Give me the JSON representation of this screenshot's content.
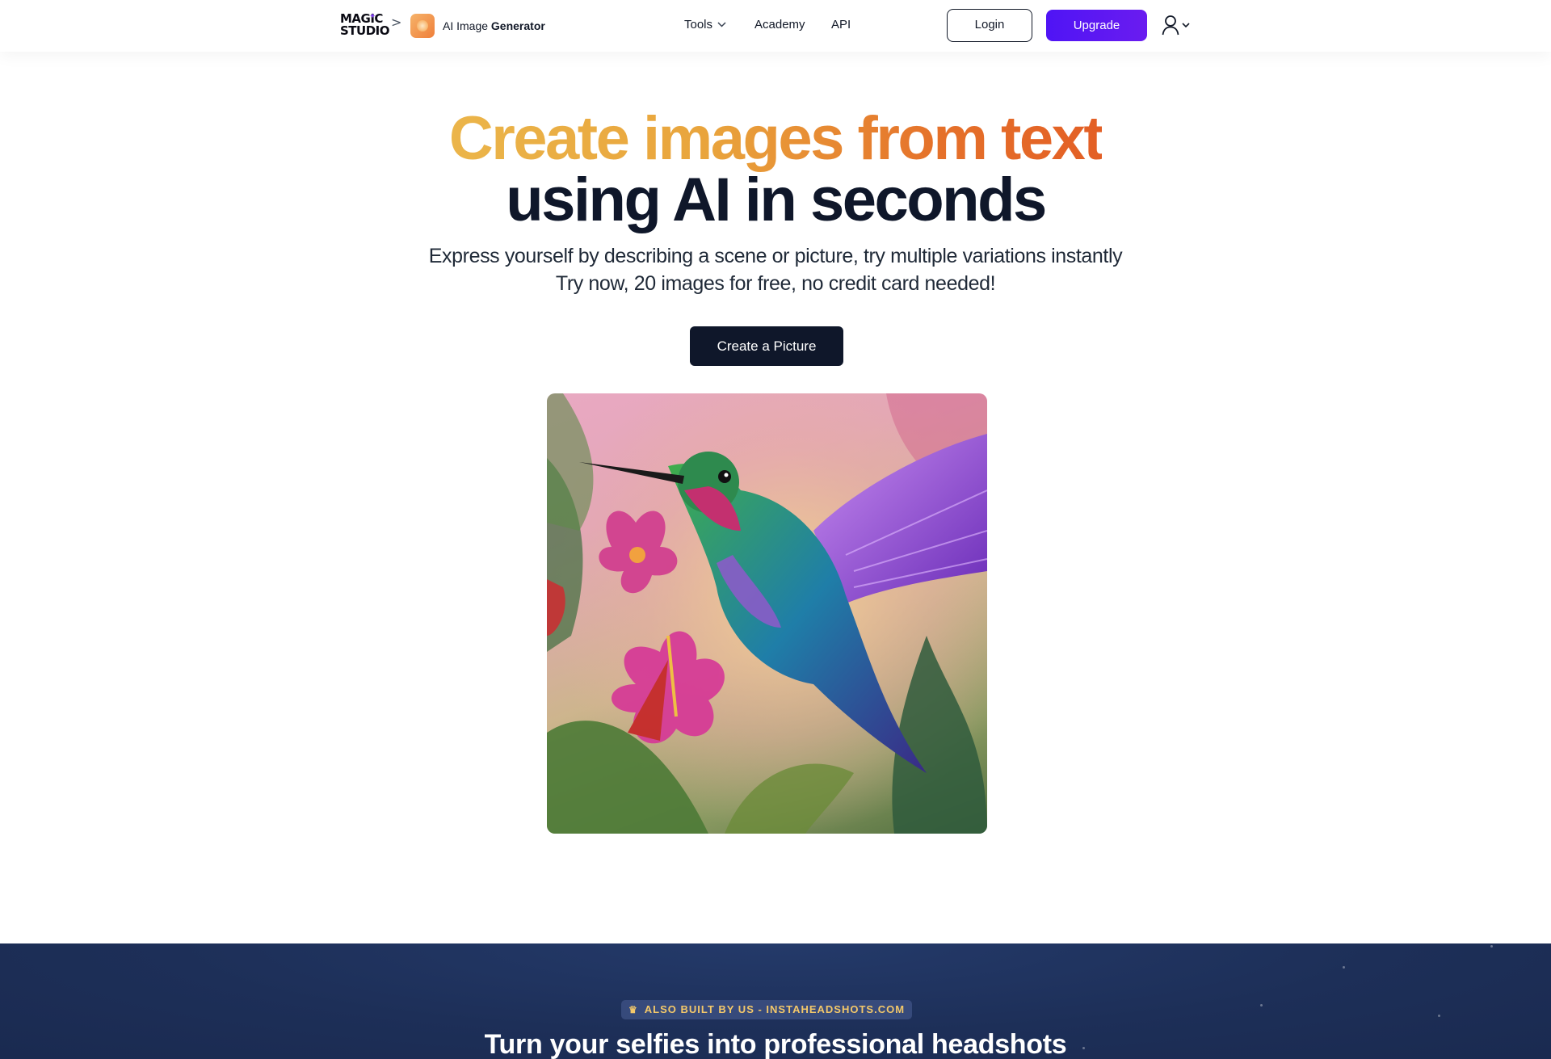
{
  "header": {
    "logo_line1": "MAGIC",
    "logo_line2": "STUDIO",
    "breadcrumb_separator": ">",
    "app_name_prefix": "AI Image",
    "app_name_bold": "Generator",
    "nav": {
      "tools": "Tools",
      "academy": "Academy",
      "api": "API"
    },
    "login_label": "Login",
    "upgrade_label": "Upgrade"
  },
  "hero": {
    "headline_gradient": "Create images from text",
    "headline_dark": "using AI in seconds",
    "subtitle_line1": "Express yourself by describing a scene or picture, try multiple variations instantly",
    "subtitle_line2": "Try now, 20 images for free, no credit card needed!",
    "cta_label": "Create a Picture"
  },
  "banner": {
    "badge": "ALSO BUILT BY US - INSTAHEADSHOTS.COM",
    "title": "Turn your selfies into professional headshots"
  },
  "colors": {
    "brand_purple": "#5b16f2",
    "headline_gradient_start": "#ebb54a",
    "headline_gradient_end": "#e35f25",
    "dark_navy": "#0f172a",
    "banner_bg": "#1d2f58",
    "badge_text": "#f3c86a"
  },
  "icons": {
    "logo_spark": "sparkle-icon",
    "breadcrumb": "chevron-right-icon",
    "app": "ai-image-generator-icon",
    "tools_dropdown": "chevron-down-icon",
    "user": "user-icon",
    "user_dropdown": "chevron-down-icon",
    "badge": "crown-icon"
  }
}
